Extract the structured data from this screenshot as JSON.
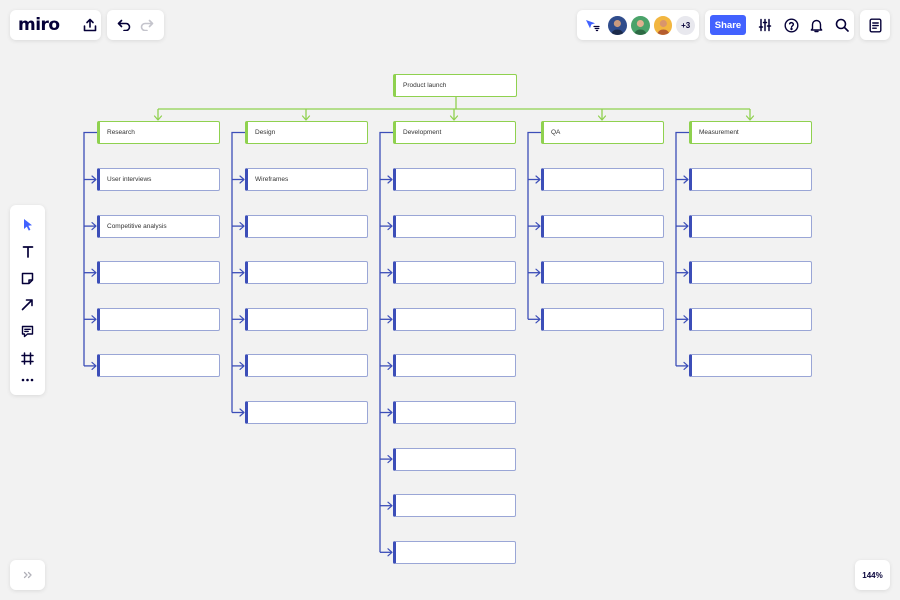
{
  "brand": {
    "logo_text": "miro"
  },
  "topbar": {
    "share_label": "Share",
    "extra_collaborators": "+3"
  },
  "zoom": {
    "level": "144%"
  },
  "colors": {
    "accent": "#4262ff",
    "root_connector": "#8fd14f",
    "child_connector": "#3c4eb8",
    "canvas": "#f2f2f2"
  },
  "icons": {
    "top_left": [
      "export-icon",
      "undo-icon",
      "redo-icon"
    ],
    "top_right": [
      "cursor-filter-icon",
      "settings-sliders-icon",
      "help-icon",
      "bell-icon",
      "search-icon",
      "notes-icon"
    ],
    "toolbar": [
      "select-icon",
      "text-icon",
      "sticky-note-icon",
      "line-arrow-icon",
      "comment-icon",
      "frame-icon",
      "more-icon"
    ],
    "bottom": [
      "expand-icon"
    ]
  },
  "board": {
    "root": {
      "label": "Product launch"
    },
    "columns": [
      {
        "label": "Research",
        "items": [
          "User interviews",
          "Competitive analysis",
          "",
          "",
          ""
        ]
      },
      {
        "label": "Design",
        "items": [
          "Wireframes",
          "",
          "",
          "",
          "",
          ""
        ]
      },
      {
        "label": "Development",
        "items": [
          "",
          "",
          "",
          "",
          "",
          "",
          "",
          "",
          ""
        ]
      },
      {
        "label": "QA",
        "items": [
          "",
          "",
          "",
          ""
        ]
      },
      {
        "label": "Measurement",
        "items": [
          "",
          "",
          "",
          "",
          ""
        ]
      }
    ]
  }
}
